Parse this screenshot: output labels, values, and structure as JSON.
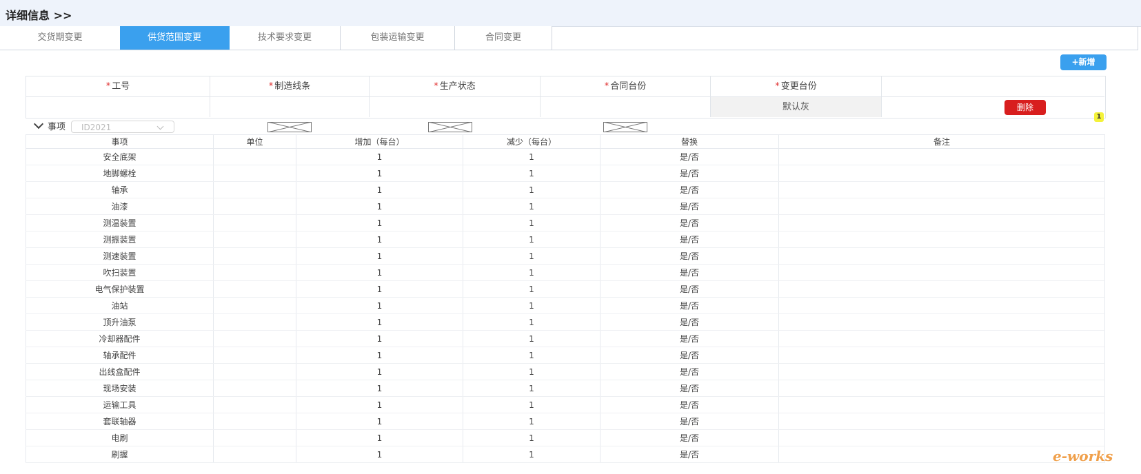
{
  "header": {
    "title": "详细信息 >>"
  },
  "tabs": [
    {
      "label": "交货期变更",
      "active": false
    },
    {
      "label": "供货范围变更",
      "active": true
    },
    {
      "label": "技术要求变更",
      "active": false
    },
    {
      "label": "包装运输变更",
      "active": false
    },
    {
      "label": "合同变更",
      "active": false
    }
  ],
  "toolbar": {
    "add_label": "+新增"
  },
  "form": {
    "required_mark": "*",
    "headers": [
      "工号",
      "制造线条",
      "生产状态",
      "合同台份",
      "变更台份"
    ],
    "job_select_placeholder": "ID2021",
    "default_gray_label": "默认灰",
    "delete_label": "删除"
  },
  "badge": "1",
  "section": {
    "title": "事项",
    "columns": [
      "事项",
      "单位",
      "增加（每台）",
      "减少（每台）",
      "替换",
      "备注"
    ],
    "rows": [
      {
        "item": "安全底架",
        "unit": "",
        "add": "1",
        "reduce": "1",
        "replace": "是/否",
        "note": ""
      },
      {
        "item": "地脚螺栓",
        "unit": "",
        "add": "1",
        "reduce": "1",
        "replace": "是/否",
        "note": ""
      },
      {
        "item": "轴承",
        "unit": "",
        "add": "1",
        "reduce": "1",
        "replace": "是/否",
        "note": ""
      },
      {
        "item": "油漆",
        "unit": "",
        "add": "1",
        "reduce": "1",
        "replace": "是/否",
        "note": ""
      },
      {
        "item": "测温装置",
        "unit": "",
        "add": "1",
        "reduce": "1",
        "replace": "是/否",
        "note": ""
      },
      {
        "item": "测振装置",
        "unit": "",
        "add": "1",
        "reduce": "1",
        "replace": "是/否",
        "note": ""
      },
      {
        "item": "测速装置",
        "unit": "",
        "add": "1",
        "reduce": "1",
        "replace": "是/否",
        "note": ""
      },
      {
        "item": "吹扫装置",
        "unit": "",
        "add": "1",
        "reduce": "1",
        "replace": "是/否",
        "note": ""
      },
      {
        "item": "电气保护装置",
        "unit": "",
        "add": "1",
        "reduce": "1",
        "replace": "是/否",
        "note": ""
      },
      {
        "item": "油站",
        "unit": "",
        "add": "1",
        "reduce": "1",
        "replace": "是/否",
        "note": ""
      },
      {
        "item": "顶升油泵",
        "unit": "",
        "add": "1",
        "reduce": "1",
        "replace": "是/否",
        "note": ""
      },
      {
        "item": "冷却器配件",
        "unit": "",
        "add": "1",
        "reduce": "1",
        "replace": "是/否",
        "note": ""
      },
      {
        "item": "轴承配件",
        "unit": "",
        "add": "1",
        "reduce": "1",
        "replace": "是/否",
        "note": ""
      },
      {
        "item": "出线盒配件",
        "unit": "",
        "add": "1",
        "reduce": "1",
        "replace": "是/否",
        "note": ""
      },
      {
        "item": "现场安装",
        "unit": "",
        "add": "1",
        "reduce": "1",
        "replace": "是/否",
        "note": ""
      },
      {
        "item": "运输工具",
        "unit": "",
        "add": "1",
        "reduce": "1",
        "replace": "是/否",
        "note": ""
      },
      {
        "item": "套联轴器",
        "unit": "",
        "add": "1",
        "reduce": "1",
        "replace": "是/否",
        "note": ""
      },
      {
        "item": "电刷",
        "unit": "",
        "add": "1",
        "reduce": "1",
        "replace": "是/否",
        "note": ""
      },
      {
        "item": "刷握",
        "unit": "",
        "add": "1",
        "reduce": "1",
        "replace": "是/否",
        "note": ""
      }
    ]
  },
  "watermark": "e-works",
  "colors": {
    "accent": "#3aa0ee",
    "danger": "#d81e1e",
    "header_bg": "#eef3fb",
    "badge": "#f4f23a"
  }
}
